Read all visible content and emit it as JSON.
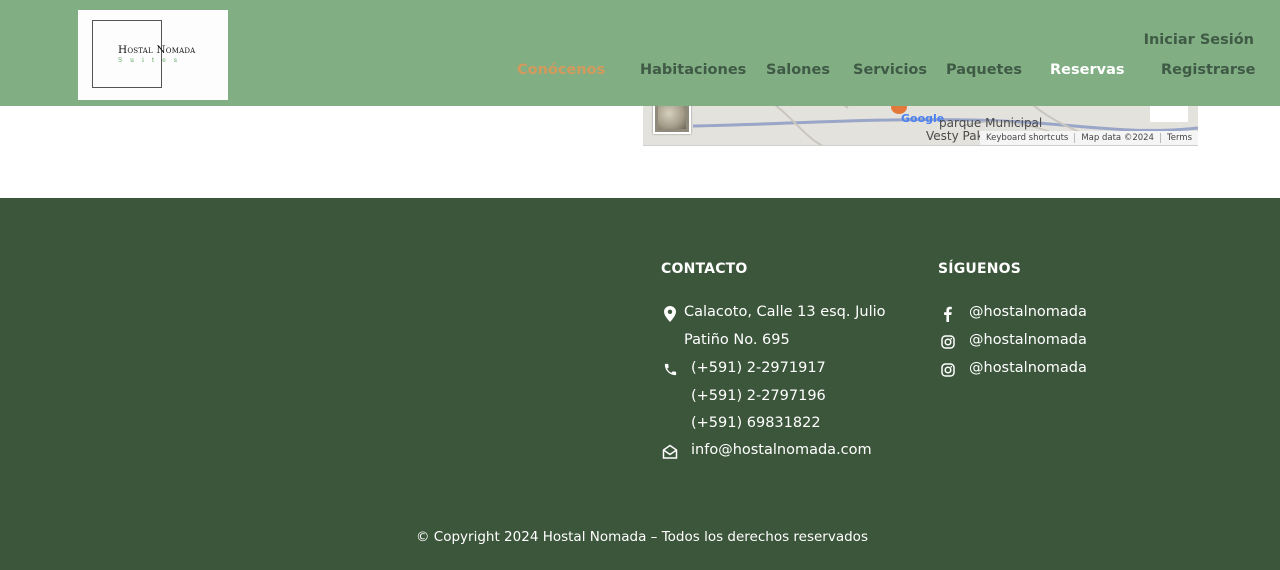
{
  "header": {
    "logo": {
      "title": "Hostal Nomada",
      "subtitle": "Suites"
    },
    "nav": [
      {
        "label": "Conócenos"
      },
      {
        "label": "Habitaciones"
      },
      {
        "label": "Salones"
      },
      {
        "label": "Servicios"
      },
      {
        "label": "Paquetes"
      },
      {
        "label": "Reservas"
      },
      {
        "label": "Registrarse"
      }
    ],
    "login_label": "Iniciar Sesión",
    "colors": {
      "background": "#82ae84",
      "nav_text": "#3f5a45",
      "active": "#d49a5c"
    }
  },
  "map": {
    "labels": [
      "parque Municipal",
      "Vesty Pak"
    ],
    "google_label": "Google",
    "attribution": [
      "Keyboard shortcuts",
      "Map data ©2024",
      "Terms"
    ]
  },
  "footer": {
    "contact": {
      "heading": "CONTACTO",
      "address": [
        "Calacoto, Calle 13 esq. Julio",
        "Patiño No. 695"
      ],
      "phones": [
        "(+591) 2-2971917",
        "(+591) 2-2797196",
        "(+591) 69831822"
      ],
      "email": "info@hostalnomada.com"
    },
    "social": {
      "heading": "SÍGUENOS",
      "items": [
        {
          "icon": "facebook-icon",
          "handle": "@hostalnomada"
        },
        {
          "icon": "instagram-icon",
          "handle": "@hostalnomada"
        },
        {
          "icon": "instagram-icon",
          "handle": "@hostalnomada"
        }
      ]
    },
    "copyright": "© Copyright 2024 Hostal Nomada – Todos los derechos reservados",
    "colors": {
      "background": "#3c563b",
      "text": "#ffffff"
    }
  }
}
